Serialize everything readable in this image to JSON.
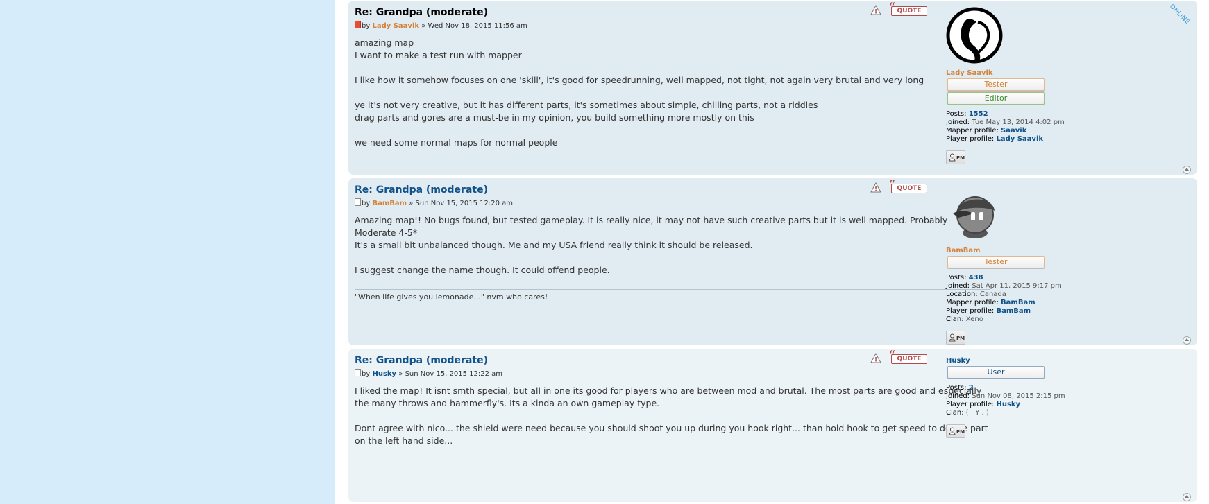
{
  "posts": [
    {
      "title": "Re: Grandpa (moderate)",
      "by": "by",
      "author": "Lady Saavik",
      "sep": "»",
      "date": "Wed Nov 18, 2015 11:56 am",
      "paragraphs": [
        "amazing map\nI want to make a test run with mapper",
        "I like how it somehow focuses on one 'skill', it's good for speedrunning, well mapped, not tight, not again very brutal and very long",
        "ye it's not very creative, but it has different parts, it's sometimes about simple, chilling parts, not a riddles\ndrag parts and gores are a must-be in my opinion, you build something more mostly on this",
        "we need some normal maps for normal people"
      ],
      "quote_label": "QUOTE",
      "online_label": "ONLINE",
      "profile": {
        "name": "Lady Saavik",
        "ranks": [
          "Tester",
          "Editor"
        ],
        "posts_label": "Posts:",
        "posts": "1552",
        "joined_label": "Joined:",
        "joined": "Tue May 13, 2014 4:02 pm",
        "mapper_label": "Mapper profile:",
        "mapper": "Saavik",
        "player_label": "Player profile:",
        "player": "Lady Saavik"
      },
      "pm_label": "PM"
    },
    {
      "title": "Re: Grandpa (moderate)",
      "by": "by",
      "author": "BamBam",
      "sep": "»",
      "date": "Sun Nov 15, 2015 12:20 am",
      "paragraphs": [
        "Amazing map!! No bugs found, but tested gameplay. It is really nice, it may not have such creative parts but it is well mapped. Probably Moderate 4-5*\nIt's a small bit unbalanced though. Me and my USA friend really think it should be released.",
        "I suggest change the name though. It could offend people."
      ],
      "signature": "\"When life gives you lemonade...\" nvm who cares!",
      "quote_label": "QUOTE",
      "profile": {
        "name": "BamBam",
        "ranks": [
          "Tester"
        ],
        "posts_label": "Posts:",
        "posts": "438",
        "joined_label": "Joined:",
        "joined": "Sat Apr 11, 2015 9:17 pm",
        "location_label": "Location:",
        "location": "Canada",
        "mapper_label": "Mapper profile:",
        "mapper": "BamBam",
        "player_label": "Player profile:",
        "player": "BamBam",
        "clan_label": "Clan:",
        "clan": "Xeno"
      },
      "pm_label": "PM"
    },
    {
      "title": "Re: Grandpa (moderate)",
      "by": "by",
      "author": "Husky",
      "sep": "»",
      "date": "Sun Nov 15, 2015 12:22 am",
      "paragraphs": [
        "I liked the map! It isnt smth special, but all in one its good for players who are between mod and brutal. The most parts are good and especially the many throws and hammerfly's. Its a kinda an own gameplay type.",
        "Dont agree with nico... the shield were need because you should shoot you up during you hook right... than hold hook to get speed to do the part on the left hand side..."
      ],
      "quote_label": "QUOTE",
      "profile": {
        "name": "Husky",
        "ranks": [
          "User"
        ],
        "posts_label": "Posts:",
        "posts": "2",
        "joined_label": "Joined:",
        "joined": "Sun Nov 08, 2015 2:15 pm",
        "player_label": "Player profile:",
        "player": "Husky",
        "clan_label": "Clan:",
        "clan": "( . Y . )"
      },
      "pm_label": "PM"
    }
  ],
  "colors": {
    "left_panel": "#d6ecfb",
    "post_bg_a": "#e1ebf2",
    "post_bg_b": "#ecf3f7",
    "link": "#105289",
    "tester": "#d5833a"
  }
}
